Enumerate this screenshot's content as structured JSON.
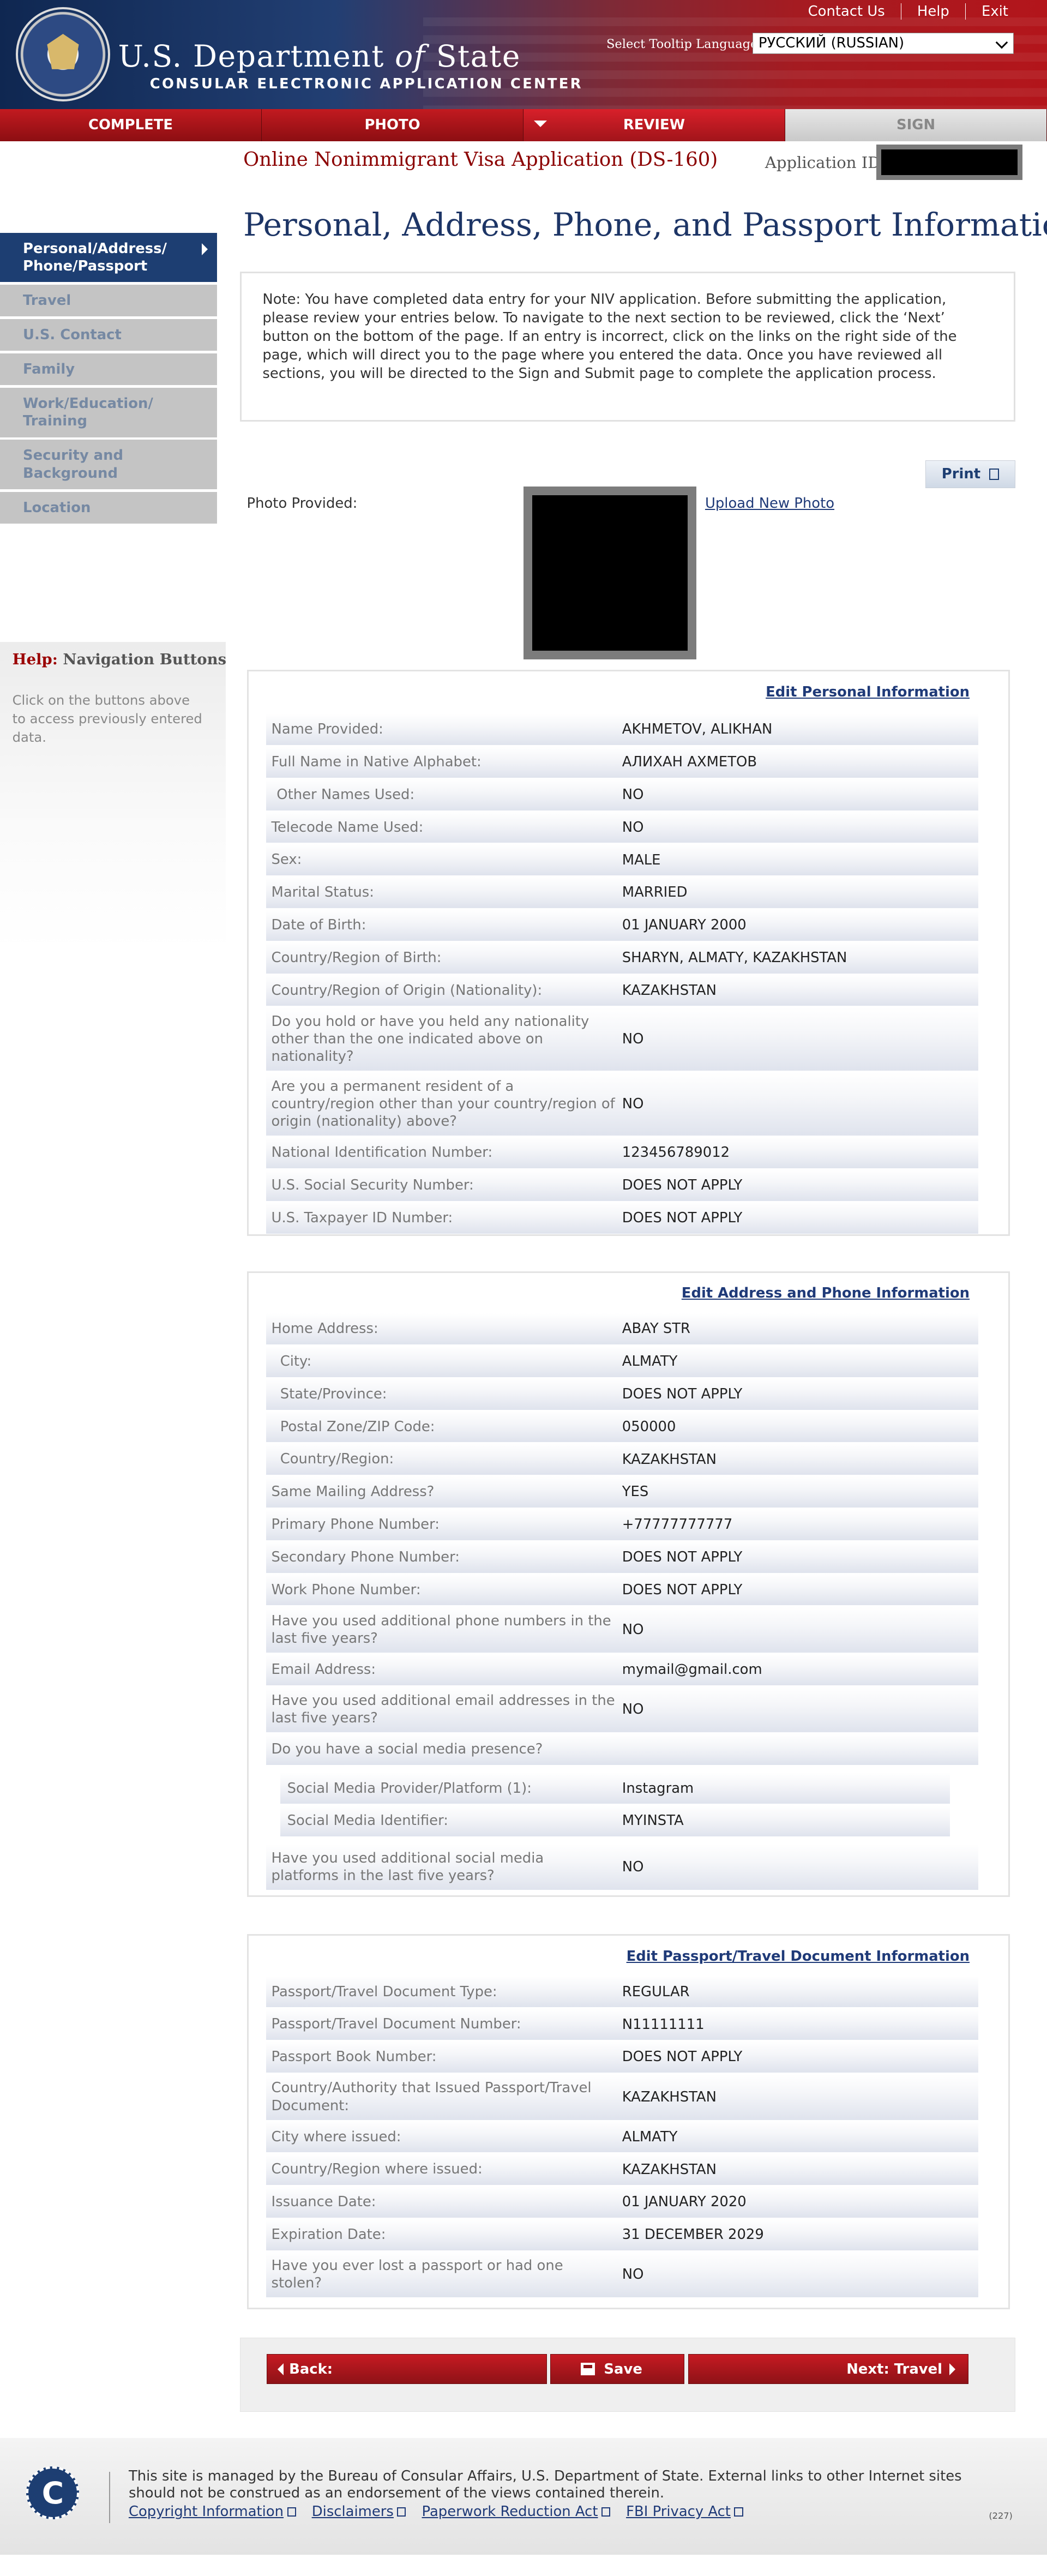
{
  "header": {
    "agency_pre": "U.S. Department",
    "agency_of": "of",
    "agency_post": "State",
    "subtitle": "CONSULAR ELECTRONIC APPLICATION CENTER",
    "links": [
      "Contact Us",
      "Help",
      "Exit"
    ],
    "tooltip_language_label": "Select Tooltip Language",
    "tooltip_language_value": "РУССКИЙ (RUSSIAN)"
  },
  "steps": [
    "COMPLETE",
    "PHOTO",
    "REVIEW",
    "SIGN"
  ],
  "app": {
    "title": "Online Nonimmigrant Visa Application (DS-160)",
    "id_label": "Application ID"
  },
  "sidebar": {
    "items": [
      "Personal/Address/ Phone/Passport",
      "Travel",
      "U.S. Contact",
      "Family",
      "Work/Education/ Training",
      "Security and Background",
      "Location"
    ],
    "help_title_prefix": "Help:",
    "help_title": "Navigation Buttons",
    "help_text": "Click on the buttons above to access previously entered data."
  },
  "main": {
    "page_title": "Personal, Address, Phone, and Passport Information",
    "note": "Note: You have completed data entry for your NIV application. Before submitting the application, please review your entries below. To navigate to the next section to be reviewed, click the ‘Next’ button on the bottom of the page. If an entry is incorrect, click on the links on the right side of the page, which will direct you to the page where you entered the data. Once you have reviewed all sections, you will be directed to the Sign and Submit page to complete the application process.",
    "print_label": "Print",
    "photo_label": "Photo Provided:",
    "upload_label": "Upload New Photo"
  },
  "personal": {
    "edit_label": "Edit Personal Information",
    "rows": [
      {
        "label": "Name Provided:",
        "value": "AKHMETOV, ALIKHAN"
      },
      {
        "label": "Full Name in Native Alphabet:",
        "value": "АЛИХАН АХМЕТОВ"
      },
      {
        "label": "Other Names Used:",
        "value": "NO"
      },
      {
        "label": "Telecode Name Used:",
        "value": "NO"
      },
      {
        "label": "Sex:",
        "value": "MALE"
      },
      {
        "label": "Marital Status:",
        "value": "MARRIED"
      },
      {
        "label": "Date of Birth:",
        "value": "01 JANUARY 2000"
      },
      {
        "label": "Country/Region of Birth:",
        "value": "SHARYN, ALMATY, KAZAKHSTAN"
      },
      {
        "label": "Country/Region of Origin (Nationality):",
        "value": "KAZAKHSTAN"
      },
      {
        "label": "Do you hold or have you held any nationality other than the one indicated above on nationality?",
        "value": "NO"
      },
      {
        "label": "Are you a permanent resident of a country/region other than your country/region of origin (nationality) above?",
        "value": "NO"
      },
      {
        "label": "National Identification Number:",
        "value": "123456789012"
      },
      {
        "label": "U.S. Social Security Number:",
        "value": "DOES NOT APPLY"
      },
      {
        "label": "U.S. Taxpayer ID Number:",
        "value": "DOES NOT APPLY"
      }
    ]
  },
  "address": {
    "edit_label": "Edit Address and Phone Information",
    "rows": [
      {
        "label": "Home Address:",
        "value": "ABAY STR"
      },
      {
        "label": "City:",
        "value": "ALMATY"
      },
      {
        "label": "State/Province:",
        "value": "DOES NOT APPLY"
      },
      {
        "label": "Postal Zone/ZIP Code:",
        "value": "050000"
      },
      {
        "label": "Country/Region:",
        "value": "KAZAKHSTAN"
      },
      {
        "label": "Same Mailing Address?",
        "value": "YES"
      },
      {
        "label": "Primary Phone Number:",
        "value": "+77777777777"
      },
      {
        "label": "Secondary Phone Number:",
        "value": "DOES NOT APPLY"
      },
      {
        "label": "Work Phone Number:",
        "value": "DOES NOT APPLY"
      },
      {
        "label": "Have you used additional phone numbers in the last five years?",
        "value": "NO"
      },
      {
        "label": "Email Address:",
        "value": "mymail@gmail.com"
      },
      {
        "label": "Have you used additional email addresses in the last five years?",
        "value": "NO"
      },
      {
        "label": "Do you have a social media presence?",
        "value": ""
      },
      {
        "label": "Social Media Provider/Platform (1):",
        "value": "Instagram"
      },
      {
        "label": "Social Media Identifier:",
        "value": "MYINSTA"
      },
      {
        "label": "Have you used additional social media platforms in the last five years?",
        "value": "NO"
      }
    ]
  },
  "passport": {
    "edit_label": "Edit Passport/Travel Document Information",
    "rows": [
      {
        "label": "Passport/Travel Document Type:",
        "value": "REGULAR"
      },
      {
        "label": "Passport/Travel Document Number:",
        "value": "N11111111"
      },
      {
        "label": "Passport Book Number:",
        "value": "DOES NOT APPLY"
      },
      {
        "label": "Country/Authority that Issued Passport/Travel Document:",
        "value": "KAZAKHSTAN"
      },
      {
        "label": "City where issued:",
        "value": "ALMATY"
      },
      {
        "label": "Country/Region where issued:",
        "value": "KAZAKHSTAN"
      },
      {
        "label": "Issuance Date:",
        "value": "01 JANUARY 2020"
      },
      {
        "label": "Expiration Date:",
        "value": "31 DECEMBER 2029"
      },
      {
        "label": "Have you ever lost a passport or had one stolen?",
        "value": "NO"
      }
    ]
  },
  "nav": {
    "back_label": "Back:",
    "save_label": "Save",
    "next_label": "Next: Travel"
  },
  "footer": {
    "logo_letter": "C",
    "text": "This site is managed by the Bureau of Consular Affairs, U.S. Department of State. External links to other Internet sites should not be construed as an endorsement of the views contained therein.",
    "links": [
      "Copyright Information",
      "Disclaimers",
      "Paperwork Reduction Act",
      "FBI Privacy Act"
    ],
    "code": "(227)"
  }
}
